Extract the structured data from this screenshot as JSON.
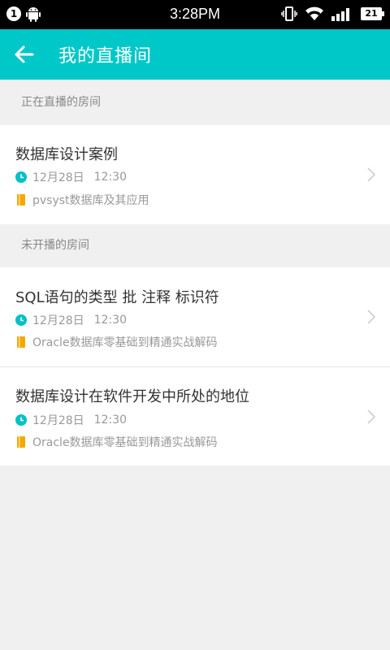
{
  "status_bar": {
    "notification_count": "1",
    "time": "3:28PM",
    "battery": "21",
    "icons": [
      "android-icon",
      "vibrate-icon",
      "wifi-icon",
      "signal-icon",
      "battery-icon"
    ]
  },
  "app_bar": {
    "title": "我的直播间",
    "back_icon": "arrow-left-icon",
    "color": "#00c8c8"
  },
  "sections": [
    {
      "header": "正在直播的房间",
      "rooms": [
        {
          "title": "数据库设计案例",
          "date": "12月28日",
          "time": "12:30",
          "course": "pvsyst数据库及其应用"
        }
      ]
    },
    {
      "header": "未开播的房间",
      "rooms": [
        {
          "title": "SQL语句的类型 批 注释 标识符",
          "date": "12月28日",
          "time": "12:30",
          "course": "Oracle数据库零基础到精通实战解码"
        },
        {
          "title": "数据库设计在软件开发中所处的地位",
          "date": "12月28日",
          "time": "12:30",
          "course": "Oracle数据库零基础到精通实战解码"
        }
      ]
    }
  ],
  "colors": {
    "clock": "#00c0c8",
    "book": "#f5a800"
  }
}
